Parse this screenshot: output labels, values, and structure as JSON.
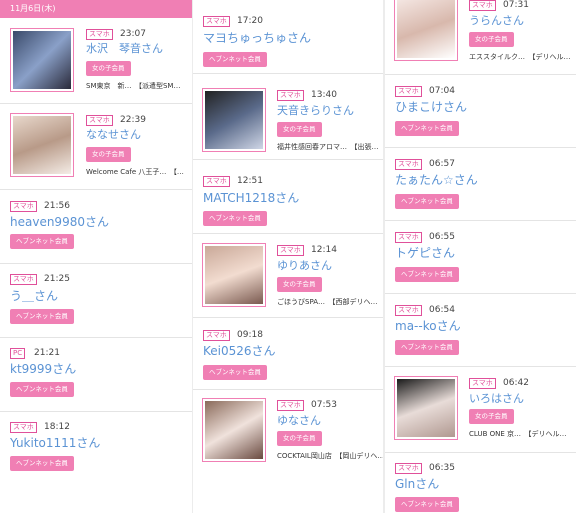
{
  "date_header": "11月6日(木)",
  "col1": [
    {
      "device": "スマホ",
      "time": "23:07",
      "name": "水沢　琴音さん",
      "role": "女の子会員",
      "desc": "SM東京　新…　【派遣型SM…"
    },
    {
      "device": "スマホ",
      "time": "22:39",
      "name": "ななせさん",
      "role": "女の子会員",
      "desc": "Welcome Cafe 八王子…　【…"
    },
    {
      "device": "スマホ",
      "time": "21:56",
      "name": "heaven9980さん",
      "role": "ヘブンネット会員"
    },
    {
      "device": "スマホ",
      "time": "21:25",
      "name": "う＿さん",
      "role": "ヘブンネット会員"
    },
    {
      "device": "PC",
      "time": "21:21",
      "name": "kt9999さん",
      "role": "ヘブンネット会員"
    },
    {
      "device": "スマホ",
      "time": "18:12",
      "name": "Yukito1111さん",
      "role": "ヘブンネット会員"
    }
  ],
  "col2": [
    {
      "device": "スマホ",
      "time": "17:20",
      "name": "マヨちゅっちゅさん",
      "role": "ヘブンネット会員"
    },
    {
      "device": "スマホ",
      "time": "13:40",
      "name": "天音きらりさん",
      "role": "女の子会員",
      "desc": "福井性感回春アロマ…　【出張…"
    },
    {
      "device": "スマホ",
      "time": "12:51",
      "name": "MATCH1218さん",
      "role": "ヘブンネット会員"
    },
    {
      "device": "スマホ",
      "time": "12:14",
      "name": "ゆりあさん",
      "role": "女の子会員",
      "desc": "ごほうびSPA…　【西部デリヘ…"
    },
    {
      "device": "スマホ",
      "time": "09:18",
      "name": "Kei0526さん",
      "role": "ヘブンネット会員"
    },
    {
      "device": "スマホ",
      "time": "07:53",
      "name": "ゆなさん",
      "role": "女の子会員",
      "desc": "COCKTAIL岡山店　【岡山デリヘ…"
    }
  ],
  "col3": [
    {
      "device": "スマホ",
      "time": "07:31",
      "name": "うらんさん",
      "role": "女の子会員",
      "desc": "エススタイルク…　【デリヘル…"
    },
    {
      "device": "スマホ",
      "time": "07:04",
      "name": "ひまこけさん",
      "role": "ヘブンネット会員"
    },
    {
      "device": "スマホ",
      "time": "06:57",
      "name": "たぁたん☆さん",
      "role": "ヘブンネット会員"
    },
    {
      "device": "スマホ",
      "time": "06:55",
      "name": "トゲピさん",
      "role": "ヘブンネット会員"
    },
    {
      "device": "スマホ",
      "time": "06:54",
      "name": "ma--koさん",
      "role": "ヘブンネット会員"
    },
    {
      "device": "スマホ",
      "time": "06:42",
      "name": "いろはさん",
      "role": "女の子会員",
      "desc": "CLUB ONE 京…　【デリヘル…"
    },
    {
      "device": "スマホ",
      "time": "06:35",
      "name": "Glnさん",
      "role": "ヘブンネット会員"
    }
  ]
}
